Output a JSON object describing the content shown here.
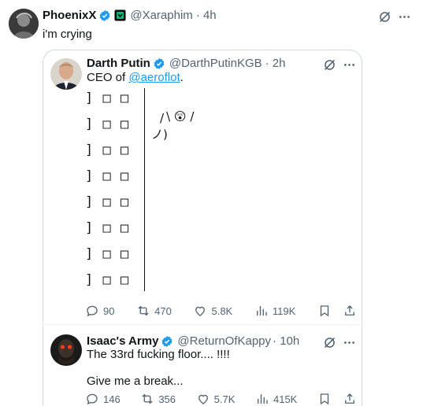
{
  "main_post": {
    "display_name": "PhoenixX",
    "handle": "@Xaraphim",
    "time": "· 4h",
    "text": "i'm crying"
  },
  "quoted_post": {
    "display_name": "Darth Putin",
    "handle": "@DarthPutinKGB",
    "time": "· 2h",
    "text_prefix": "CEO of ",
    "mention": "@aeroflot",
    "text_suffix": ".",
    "ascii_rows": [
      "] □ □",
      "] □ □",
      "] □ □",
      "] □ □",
      "] □ □",
      "] □ □",
      "] □ □",
      "] □ □"
    ],
    "art": {
      "line1_left": "\\",
      "emoji": "😲",
      "line1_right": "/",
      "line2": "/",
      "line3": "ノ)"
    },
    "stats": {
      "replies": "90",
      "reposts": "470",
      "likes": "5.8K",
      "views": "119K"
    }
  },
  "reply_post": {
    "display_name": "Isaac's Army",
    "handle": "@ReturnOfKappy",
    "time": "· 10h",
    "line1": "The 33rd fucking floor.... !!!!",
    "line2": "Give me a break...",
    "stats": {
      "replies": "146",
      "reposts": "356",
      "likes": "5.7K",
      "views": "415K"
    }
  },
  "colors": {
    "text": "#0f1419",
    "muted": "#536471",
    "accent": "#1d9bf0",
    "border": "#cfd9de",
    "verified_blue": "#1d9bf0",
    "affiliate_green": "#00ba7c"
  },
  "icons": [
    "grok-icon",
    "more-icon",
    "reply-icon",
    "repost-icon",
    "like-icon",
    "views-icon",
    "bookmark-icon",
    "share-icon",
    "verified-icon"
  ]
}
